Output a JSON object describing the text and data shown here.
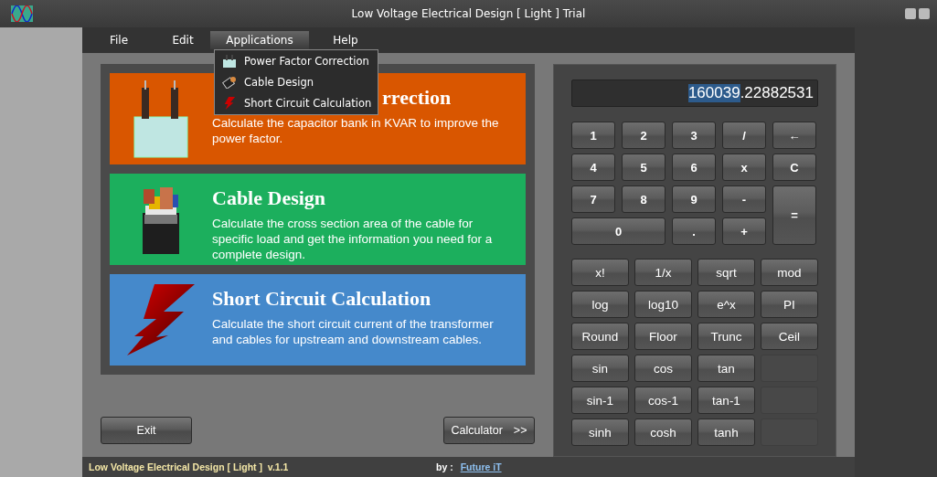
{
  "window": {
    "title": "Low Voltage Electrical Design [ Light ] Trial"
  },
  "menu": [
    {
      "label": "File",
      "selected": false
    },
    {
      "label": "Edit",
      "selected": false
    },
    {
      "label": "Applications",
      "selected": true
    },
    {
      "label": "Help",
      "selected": false
    }
  ],
  "dropdown": [
    {
      "label": "Power Factor Correction",
      "kind": "capacitor"
    },
    {
      "label": "Cable Design",
      "kind": "cable"
    },
    {
      "label": "Short Circuit Calculation",
      "kind": "bolt"
    }
  ],
  "cards": [
    {
      "title": "rrection",
      "description": "Calculate the capacitor bank in KVAR to improve the power factor.",
      "color": "#d95600",
      "kind": "capacitor"
    },
    {
      "title": "Cable Design",
      "description": "Calculate the cross section area of the cable for specific load and get the information you need for a complete design.",
      "color": "#1caf5d",
      "kind": "cable"
    },
    {
      "title": "Short Circuit Calculation",
      "description": "Calculate the short circuit current of the transformer and cables for upstream and downstream cables.",
      "color": "#4589cb",
      "kind": "bolt"
    }
  ],
  "buttons": {
    "exit": "Exit",
    "calculator": "Calculator",
    "calculator_arrow": ">>"
  },
  "calculator": {
    "display": {
      "selection": "160039",
      "rest": ".22882531"
    },
    "keys": [
      {
        "label": "1",
        "kind": "key"
      },
      {
        "label": "2",
        "kind": "key"
      },
      {
        "label": "3",
        "kind": "key"
      },
      {
        "label": "/",
        "kind": "key"
      },
      {
        "label": "←",
        "kind": "key"
      },
      {
        "label": "4",
        "kind": "key"
      },
      {
        "label": "5",
        "kind": "key"
      },
      {
        "label": "6",
        "kind": "key"
      },
      {
        "label": "x",
        "kind": "key"
      },
      {
        "label": "C",
        "kind": "key"
      },
      {
        "label": "7",
        "kind": "key"
      },
      {
        "label": "8",
        "kind": "key"
      },
      {
        "label": "9",
        "kind": "key"
      },
      {
        "label": "-",
        "kind": "key"
      },
      {
        "label": "=",
        "kind": "tall"
      },
      {
        "label": "0",
        "kind": "wide"
      },
      {
        "label": ".",
        "kind": "key"
      },
      {
        "label": "+",
        "kind": "key"
      }
    ],
    "functions": [
      {
        "label": "x!",
        "kind": "key"
      },
      {
        "label": "1/x",
        "kind": "key"
      },
      {
        "label": "sqrt",
        "kind": "key"
      },
      {
        "label": "mod",
        "kind": "key"
      },
      {
        "label": "log",
        "kind": "key"
      },
      {
        "label": "log10",
        "kind": "key"
      },
      {
        "label": "e^x",
        "kind": "key"
      },
      {
        "label": "PI",
        "kind": "key"
      },
      {
        "label": "Round",
        "kind": "key"
      },
      {
        "label": "Floor",
        "kind": "key"
      },
      {
        "label": "Trunc",
        "kind": "key"
      },
      {
        "label": "Ceil",
        "kind": "key"
      },
      {
        "label": "sin",
        "kind": "key"
      },
      {
        "label": "cos",
        "kind": "key"
      },
      {
        "label": "tan",
        "kind": "key"
      },
      {
        "kind": "blank"
      },
      {
        "label": "sin-1",
        "kind": "key"
      },
      {
        "label": "cos-1",
        "kind": "key"
      },
      {
        "label": "tan-1",
        "kind": "key"
      },
      {
        "kind": "blank"
      },
      {
        "label": "sinh",
        "kind": "key"
      },
      {
        "label": "cosh",
        "kind": "key"
      },
      {
        "label": "tanh",
        "kind": "key"
      },
      {
        "kind": "blank"
      }
    ]
  },
  "status_bar": {
    "product": "Low Voltage Electrical Design [ Light ]  v.1.1",
    "by": "by :",
    "link": "Future iT"
  }
}
